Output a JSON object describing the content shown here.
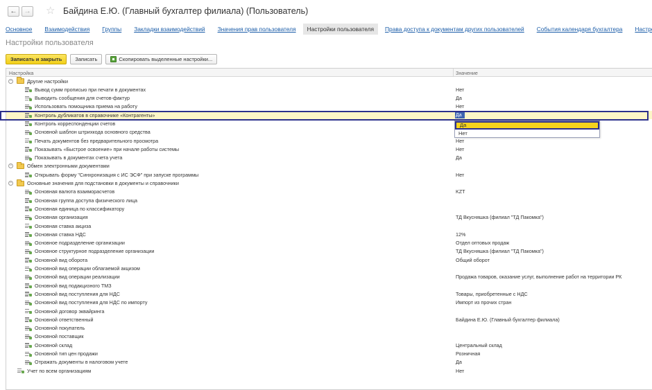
{
  "window": {
    "title": "Байдина Е.Ю. (Главный бухгалтер филиала) (Пользователь)"
  },
  "tabs": [
    {
      "label": "Основное",
      "active": false
    },
    {
      "label": "Взаимодействия",
      "active": false
    },
    {
      "label": "Группы",
      "active": false
    },
    {
      "label": "Закладки взаимодействий",
      "active": false
    },
    {
      "label": "Значения прав пользователя",
      "active": false
    },
    {
      "label": "Настройки пользователя",
      "active": true
    },
    {
      "label": "Права доступа к документам других пользователей",
      "active": false
    },
    {
      "label": "События календаря бухгалтера",
      "active": false
    },
    {
      "label": "Настройки",
      "active": false
    }
  ],
  "section_title": "Настройки пользователя",
  "toolbar": {
    "save_close": "Записать и закрыть",
    "save": "Записать",
    "copy": "Скопировать выделенные настройки..."
  },
  "table": {
    "col_setting": "Настройка",
    "col_value": "Значение",
    "rows": [
      {
        "type": "group",
        "label": "Другие настройки",
        "value": ""
      },
      {
        "type": "item",
        "label": "Вывод сумм прописью при печати в документах",
        "value": "Нет"
      },
      {
        "type": "item",
        "label": "Выводить сообщения для счетов-фактур",
        "value": "Да"
      },
      {
        "type": "item",
        "label": "Использовать помощника приема на работу",
        "value": "Нет"
      },
      {
        "type": "item",
        "label": "Контроль дубликатов в справочнике «Контрагенты»",
        "value": "Да",
        "selected": true
      },
      {
        "type": "item",
        "label": "Контроль корреспонденции счетов",
        "value": ""
      },
      {
        "type": "item",
        "label": "Основной шаблон штрихкода основного средства",
        "value": ""
      },
      {
        "type": "item",
        "label": "Печать документов без предварительного просмотра",
        "value": "Нет"
      },
      {
        "type": "item",
        "label": "Показывать «Быстрое освоение» при начале работы системы",
        "value": "Нет"
      },
      {
        "type": "item",
        "label": "Показывать в документах счета учета",
        "value": "Да"
      },
      {
        "type": "group",
        "label": "Обмен электронными документами",
        "value": ""
      },
      {
        "type": "item",
        "label": "Открывать форму \"Синхронизация с ИС ЭСФ\" при запуске программы",
        "value": "Нет"
      },
      {
        "type": "group",
        "label": "Основные значения для подстановки в документы и справочники",
        "value": ""
      },
      {
        "type": "item",
        "label": "Основная валюта взаиморасчетов",
        "value": "KZT"
      },
      {
        "type": "item",
        "label": "Основная группа доступа физического лица",
        "value": ""
      },
      {
        "type": "item",
        "label": "Основная единица по классификатору",
        "value": ""
      },
      {
        "type": "item",
        "label": "Основная организация",
        "value": "ТД Вкусняшка (филиал \"ТД Пакомка\")"
      },
      {
        "type": "item",
        "label": "Основная ставка акциза",
        "value": ""
      },
      {
        "type": "item",
        "label": "Основная ставка НДС",
        "value": "12%"
      },
      {
        "type": "item",
        "label": "Основное подразделение организации",
        "value": "Отдел оптовых продаж"
      },
      {
        "type": "item",
        "label": "Основное структурное подразделение организации",
        "value": "ТД Вкусняшка (филиал \"ТД Пакомка\")"
      },
      {
        "type": "item",
        "label": "Основной вид оборота",
        "value": "Общий оборот"
      },
      {
        "type": "item",
        "label": "Основной вид операции облагаемой акцизом",
        "value": ""
      },
      {
        "type": "item",
        "label": "Основной вид операции реализации",
        "value": "Продажа товаров, оказание услуг, выполнение работ на территории РК"
      },
      {
        "type": "item",
        "label": "Основной вид подакцизного ТМЗ",
        "value": ""
      },
      {
        "type": "item",
        "label": "Основной вид поступления для НДС",
        "value": "Товары, приобретенные с НДС"
      },
      {
        "type": "item",
        "label": "Основной вид поступления для НДС по импорту",
        "value": "Импорт из прочих стран"
      },
      {
        "type": "item",
        "label": "Основной договор эквайринга",
        "value": ""
      },
      {
        "type": "item",
        "label": "Основной ответственный",
        "value": "Байдина Е.Ю. (Главный бухгалтер филиала)"
      },
      {
        "type": "item",
        "label": "Основной покупатель",
        "value": ""
      },
      {
        "type": "item",
        "label": "Основной поставщик",
        "value": ""
      },
      {
        "type": "item",
        "label": "Основной склад",
        "value": "Центральный склад"
      },
      {
        "type": "item",
        "label": "Основной тип цен продажи",
        "value": "Розничная"
      },
      {
        "type": "item",
        "label": "Отражать документы в налоговом учете",
        "value": "Да"
      },
      {
        "type": "root-item",
        "label": "Учет по всем организациям",
        "value": "Нет"
      }
    ]
  },
  "dropdown": {
    "current": "Да",
    "options": [
      "Да",
      "Нет"
    ],
    "highlighted": "Да"
  }
}
